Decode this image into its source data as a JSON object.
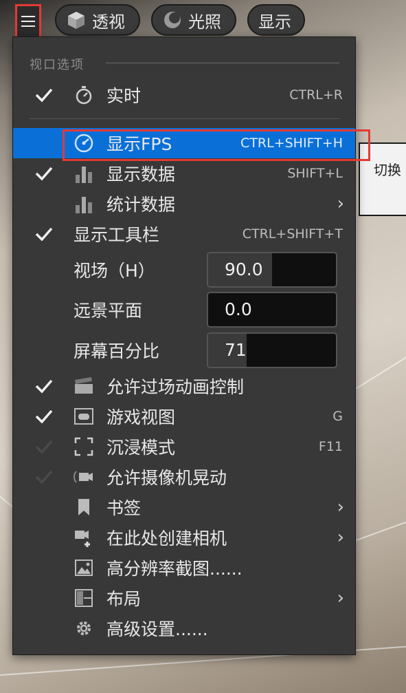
{
  "toolbar": {
    "buttons": [
      {
        "label": "透视",
        "icon": "cube-icon"
      },
      {
        "label": "光照",
        "icon": "sphere-icon"
      },
      {
        "label": "显示",
        "icon": ""
      }
    ]
  },
  "menu": {
    "section_header": "视口选项",
    "items": [
      {
        "label": "实时",
        "shortcut": "CTRL+R",
        "checked": true,
        "icon": "stopwatch-icon"
      },
      {
        "label": "显示FPS",
        "shortcut": "CTRL+SHIFT+H",
        "checked": false,
        "icon": "gauge-icon",
        "selected": true
      },
      {
        "label": "显示数据",
        "shortcut": "SHIFT+L",
        "checked": true,
        "icon": "bar-chart-icon"
      },
      {
        "label": "统计数据",
        "shortcut": "",
        "checked": false,
        "icon": "bar-chart-icon",
        "submenu": true
      },
      {
        "label": "显示工具栏",
        "shortcut": "CTRL+SHIFT+T",
        "checked": true
      },
      {
        "label": "允许过场动画控制",
        "checked": true,
        "icon": "clapperboard-icon"
      },
      {
        "label": "游戏视图",
        "shortcut": "G",
        "checked": true,
        "icon": "gamepad-icon"
      },
      {
        "label": "沉浸模式",
        "shortcut": "F11",
        "checked": false,
        "icon": "fullscreen-icon"
      },
      {
        "label": "允许摄像机晃动",
        "checked": false,
        "icon": "camera-shake-icon"
      },
      {
        "label": "书签",
        "icon": "bookmark-icon",
        "submenu": true
      },
      {
        "label": "在此处创建相机",
        "icon": "add-camera-icon",
        "submenu": true
      },
      {
        "label": "高分辨率截图......",
        "icon": "image-icon"
      },
      {
        "label": "布局",
        "icon": "layout-icon",
        "submenu": true
      },
      {
        "label": "高级设置......",
        "icon": "gear-icon"
      }
    ],
    "fields": [
      {
        "label": "视场（H）",
        "value": "90.0",
        "fill": 0.5
      },
      {
        "label": "远景平面",
        "value": "0.0",
        "fill": 0
      },
      {
        "label": "屏幕百分比",
        "value": "71",
        "fill": 0.3
      }
    ]
  },
  "tooltip": {
    "text": "切换"
  },
  "colors": {
    "menu_bg": "#383838",
    "selected": "#0a70d8",
    "highlight_box": "#e53935"
  }
}
